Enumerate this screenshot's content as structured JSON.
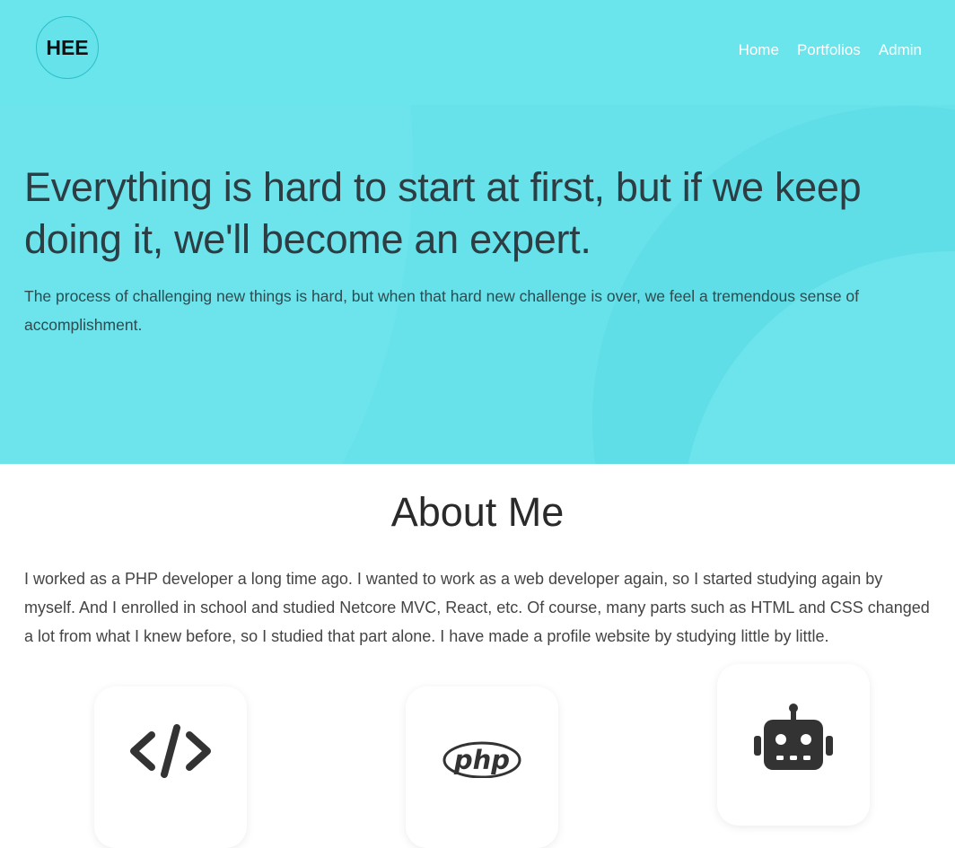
{
  "header": {
    "logo_text": "HEE",
    "nav": [
      {
        "label": "Home"
      },
      {
        "label": "Portfolios"
      },
      {
        "label": "Admin"
      }
    ]
  },
  "hero": {
    "headline": "Everything is hard to start at first, but if we keep doing it, we'll become an expert.",
    "subline": "The process of challenging new things is hard, but when that hard new challenge is over, we feel a tremendous sense of accomplishment."
  },
  "about": {
    "title": "About Me",
    "text": "I worked as a PHP developer a long time ago. I wanted to work as a web developer again, so I started studying again by myself. And I enrolled in school and studied Netcore MVC, React, etc. Of course, many parts such as HTML and CSS changed a lot from what I knew before, so I studied that part alone. I have made a profile website by studying little by little.",
    "cards": [
      {
        "icon": "code-icon"
      },
      {
        "icon": "php-icon",
        "label": "php"
      },
      {
        "icon": "robot-icon"
      }
    ]
  },
  "colors": {
    "hero_bg": "#67e1ea",
    "nav_text": "#ffffff",
    "icon": "#333333"
  }
}
